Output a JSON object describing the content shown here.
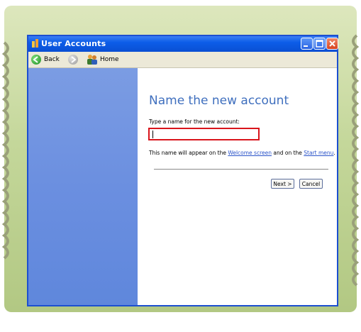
{
  "window": {
    "title": "User Accounts",
    "controls": {
      "minimize_icon": "minimize-icon",
      "maximize_icon": "maximize-icon",
      "close_icon": "close-icon"
    }
  },
  "toolbar": {
    "back_label": "Back",
    "home_label": "Home",
    "back_icon": "back-arrow-icon",
    "forward_icon": "forward-arrow-icon",
    "home_icon": "users-home-icon"
  },
  "main": {
    "heading": "Name the new account",
    "prompt": "Type a name for the new account:",
    "name_value": "",
    "note_prefix": "This name will appear on the ",
    "note_link1": "Welcome screen",
    "note_middle": " and on the ",
    "note_link2": "Start menu",
    "note_suffix": ".",
    "next_label": "Next >",
    "cancel_label": "Cancel"
  },
  "caption": "",
  "colors": {
    "accent": "#3f6fbe",
    "highlight": "#d9141b",
    "titlebar": "#0c5de8",
    "pane": "#6b8fe0"
  }
}
